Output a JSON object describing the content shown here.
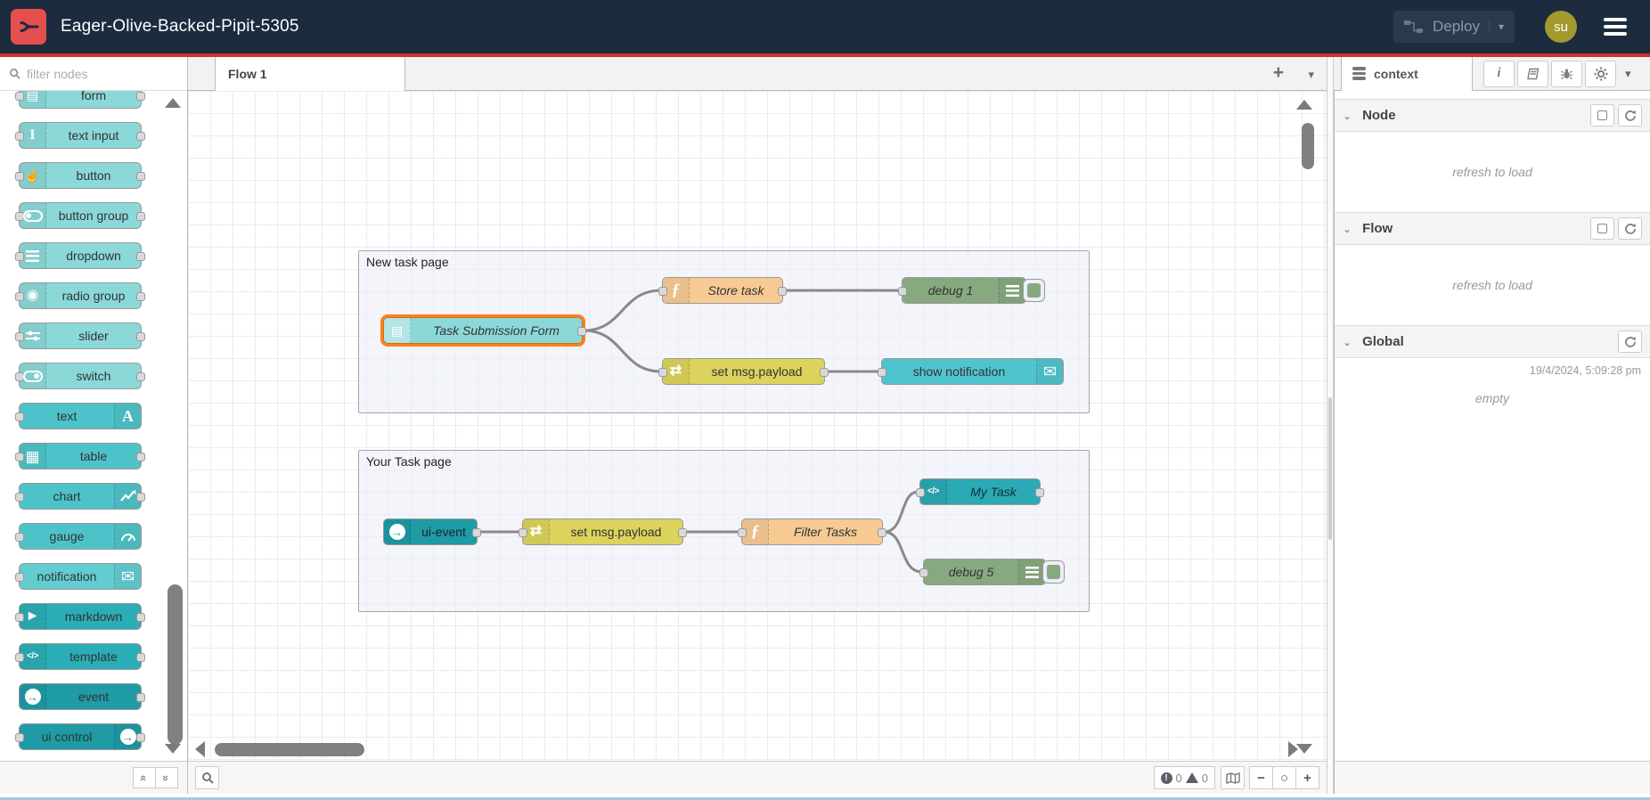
{
  "header": {
    "title": "Eager-Olive-Backed-Pipit-5305",
    "deploy_label": "Deploy",
    "user_initials": "su"
  },
  "palette": {
    "filter_placeholder": "filter nodes",
    "items": [
      {
        "label": "form",
        "icon": "form-icon"
      },
      {
        "label": "text input",
        "icon": "text-cursor-icon"
      },
      {
        "label": "button",
        "icon": "hand-pointer-icon"
      },
      {
        "label": "button group",
        "icon": "toggle-group-icon"
      },
      {
        "label": "dropdown",
        "icon": "list-bars-icon"
      },
      {
        "label": "radio group",
        "icon": "radio-icon"
      },
      {
        "label": "slider",
        "icon": "slider-icon"
      },
      {
        "label": "switch",
        "icon": "switch-icon"
      },
      {
        "label": "text",
        "icon": "font-icon"
      },
      {
        "label": "table",
        "icon": "table-icon"
      },
      {
        "label": "chart",
        "icon": "chart-line-icon"
      },
      {
        "label": "gauge",
        "icon": "gauge-icon"
      },
      {
        "label": "notification",
        "icon": "envelope-icon"
      },
      {
        "label": "markdown",
        "icon": "play-arrow-icon"
      },
      {
        "label": "template",
        "icon": "code-icon"
      },
      {
        "label": "event",
        "icon": "arrow-circle-icon"
      },
      {
        "label": "ui control",
        "icon": "arrow-circle-icon"
      }
    ]
  },
  "workspace": {
    "tab_label": "Flow 1",
    "groups": [
      {
        "label": "New task page"
      },
      {
        "label": "Your Task page"
      }
    ],
    "nodes": [
      {
        "label": "Task Submission Form",
        "icon": "form-icon"
      },
      {
        "label": "Store task",
        "icon": "function-icon"
      },
      {
        "label": "debug 1",
        "icon": "debug-list-icon"
      },
      {
        "label": "set msg.payload",
        "icon": "shuffle-icon"
      },
      {
        "label": "show notification",
        "icon": "envelope-icon"
      },
      {
        "label": "ui-event",
        "icon": "arrow-circle-icon"
      },
      {
        "label": "set msg.payload",
        "icon": "shuffle-icon"
      },
      {
        "label": "Filter Tasks",
        "icon": "function-icon"
      },
      {
        "label": "My Task",
        "icon": "code-icon"
      },
      {
        "label": "debug 5",
        "icon": "debug-list-icon"
      }
    ]
  },
  "sidebar": {
    "tab_label": "context",
    "sections": [
      {
        "label": "Node",
        "body": "refresh to load"
      },
      {
        "label": "Flow",
        "body": "refresh to load"
      },
      {
        "label": "Global",
        "timestamp": "19/4/2024, 5:09:28 pm",
        "body": "empty"
      }
    ]
  },
  "canvas_footer": {
    "error_count": "0",
    "warning_count": "0"
  },
  "glyphs": {
    "form": "▤",
    "radio": "◉",
    "table": "▦",
    "envelope": "✉",
    "play": "►",
    "code": "</>",
    "arrow": "→",
    "function": "ƒ",
    "shuffle": "⇄",
    "hand": "☝",
    "font": "A",
    "ibeam": "I",
    "plus": "+",
    "minus": "−",
    "circle": "○",
    "chevron_down": "▾",
    "section_chevron": "⌄",
    "double_chevron": "«",
    "double_chevron_rev": "»",
    "info": "i"
  },
  "colors": {
    "header_bg": "#1C2B3E",
    "accent_red": "#D32F2F",
    "logo_red": "#E5504E",
    "user_badge": "#A39A2D",
    "selection": "#FF7F1A",
    "node_light": "#8BD8D8",
    "node_medium": "#4DC3C9",
    "node_notification": "#63CCD1",
    "node_dark": "#2AADB6",
    "node_darkest": "#1E9BA5",
    "node_function": "#F7CA94",
    "node_change": "#DBD35C",
    "node_debug": "#87A980",
    "node_template": "#2BA9B4",
    "wire": "#8A8A8A"
  }
}
